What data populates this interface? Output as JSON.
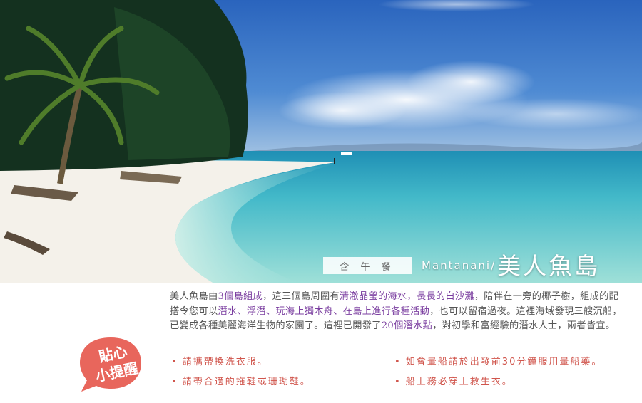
{
  "banner": {
    "meal_label": "含 午 餐",
    "title_en": "Mantanani/",
    "title_zh": "美人魚島"
  },
  "description": {
    "segments": [
      {
        "text": "美人魚島由",
        "hl": false
      },
      {
        "text": "3個島組成",
        "hl": true
      },
      {
        "text": "，這三個島周圍有",
        "hl": false
      },
      {
        "text": "清澈晶瑩的海水，長長的白沙灘",
        "hl": true
      },
      {
        "text": "，陪伴在一旁的椰子樹，組成的配搭令您可以",
        "hl": false
      },
      {
        "text": "潛水、浮潛、玩海上獨木舟、在島上進行各種活動",
        "hl": true
      },
      {
        "text": "，也可以留宿過夜。這裡海域發現三艘沉船，已變成各種美麗海洋生物的家園了。這裡已開發了",
        "hl": false
      },
      {
        "text": "20個潛水點",
        "hl": true
      },
      {
        "text": "，對初學和富經驗的潛水人士，兩者皆宜。",
        "hl": false
      }
    ]
  },
  "tips_badge": {
    "line1": "貼心",
    "line2": "小提醒",
    "color": "#e8665c"
  },
  "tips": [
    "• 請攜帶換洗衣服。",
    "• 如會暈船請於出發前30分鐘服用暈船藥。",
    "• 請帶合適的拖鞋或珊瑚鞋。",
    "• 船上務必穿上救生衣。"
  ],
  "colors": {
    "sky": "#2f6fc4",
    "sea": "#5cc9cf",
    "sand": "#f4f1ea",
    "highlight": "#7b3fa0",
    "tip_text": "#d0554c"
  }
}
